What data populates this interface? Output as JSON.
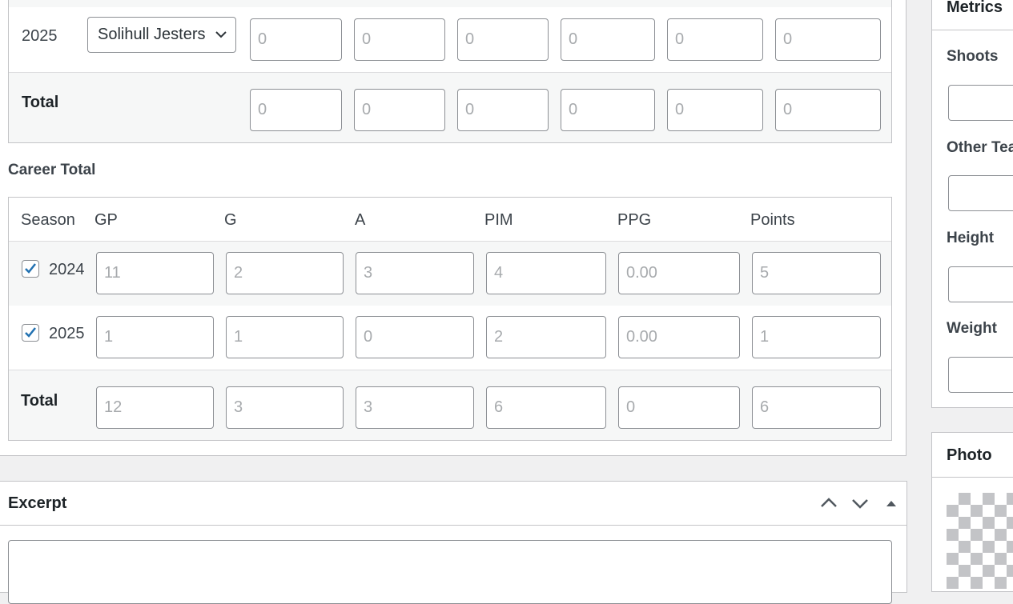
{
  "season_table": {
    "row": {
      "season": "2025",
      "team": "Solihull Jesters",
      "values": [
        "0",
        "0",
        "0",
        "0",
        "0",
        "0"
      ]
    },
    "total": {
      "label": "Total",
      "values": [
        "0",
        "0",
        "0",
        "0",
        "0",
        "0"
      ]
    }
  },
  "career": {
    "heading": "Career Total",
    "columns": [
      "Season",
      "GP",
      "G",
      "A",
      "PIM",
      "PPG",
      "Points"
    ],
    "rows": [
      {
        "season": "2024",
        "checked": true,
        "values": [
          "11",
          "2",
          "3",
          "4",
          "0.00",
          "5"
        ]
      },
      {
        "season": "2025",
        "checked": true,
        "values": [
          "1",
          "1",
          "0",
          "2",
          "0.00",
          "1"
        ]
      }
    ],
    "total": {
      "label": "Total",
      "values": [
        "12",
        "3",
        "3",
        "6",
        "0",
        "6"
      ]
    }
  },
  "excerpt": {
    "title": "Excerpt",
    "icons": [
      "chevron-up-icon",
      "chevron-down-icon",
      "triangle-up-icon"
    ]
  },
  "sidebar": {
    "metrics": {
      "title": "Metrics",
      "fields": [
        "Shoots",
        "Other Tea",
        "Height",
        "Weight"
      ]
    },
    "photo": {
      "title": "Photo"
    }
  },
  "colors": {
    "checkbox_blue": "#2271b1",
    "border": "#c3c4c7",
    "placeholder_text": "#a7aaad"
  }
}
